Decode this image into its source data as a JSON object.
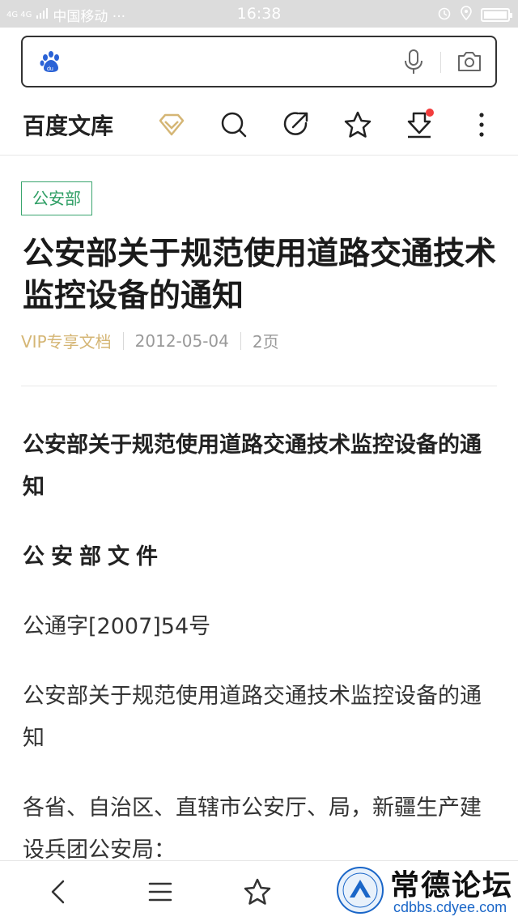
{
  "status_bar": {
    "network_top": "4G 4G",
    "carrier": "中国移动 ···",
    "time": "16:38",
    "battery_level": 1.0
  },
  "search": {
    "value": "",
    "placeholder": ""
  },
  "toolbar": {
    "brand": "百度文库",
    "icons": [
      "vip-diamond-icon",
      "search-icon",
      "share-icon",
      "star-icon",
      "download-icon",
      "more-icon"
    ],
    "download_has_badge": true
  },
  "document": {
    "category_tag": "公安部",
    "title": "公安部关于规范使用道路交通技术监控设备的通知",
    "vip_label": "VIP专享文档",
    "date": "2012-05-04",
    "pages": "2页"
  },
  "content": {
    "heading": "公安部关于规范使用道路交通技术监控设备的通知",
    "agency": "公安部文件",
    "doc_number": "公通字[2007]54号",
    "subtitle": "公安部关于规范使用道路交通技术监控设备的通知",
    "addressee": "各省、自治区、直辖市公安厅、局，新疆生产建设兵团公安局："
  },
  "bottom_nav": {
    "items": [
      "back-icon",
      "menu-icon",
      "bookmark-icon"
    ]
  },
  "watermark": {
    "text": "常德论坛",
    "url": "cdbbs.cdyee.com"
  },
  "colors": {
    "accent_green": "#2e9e64",
    "vip_gold": "#d5b675",
    "badge_red": "#f23d3d",
    "baidu_blue": "#2a62d6"
  }
}
